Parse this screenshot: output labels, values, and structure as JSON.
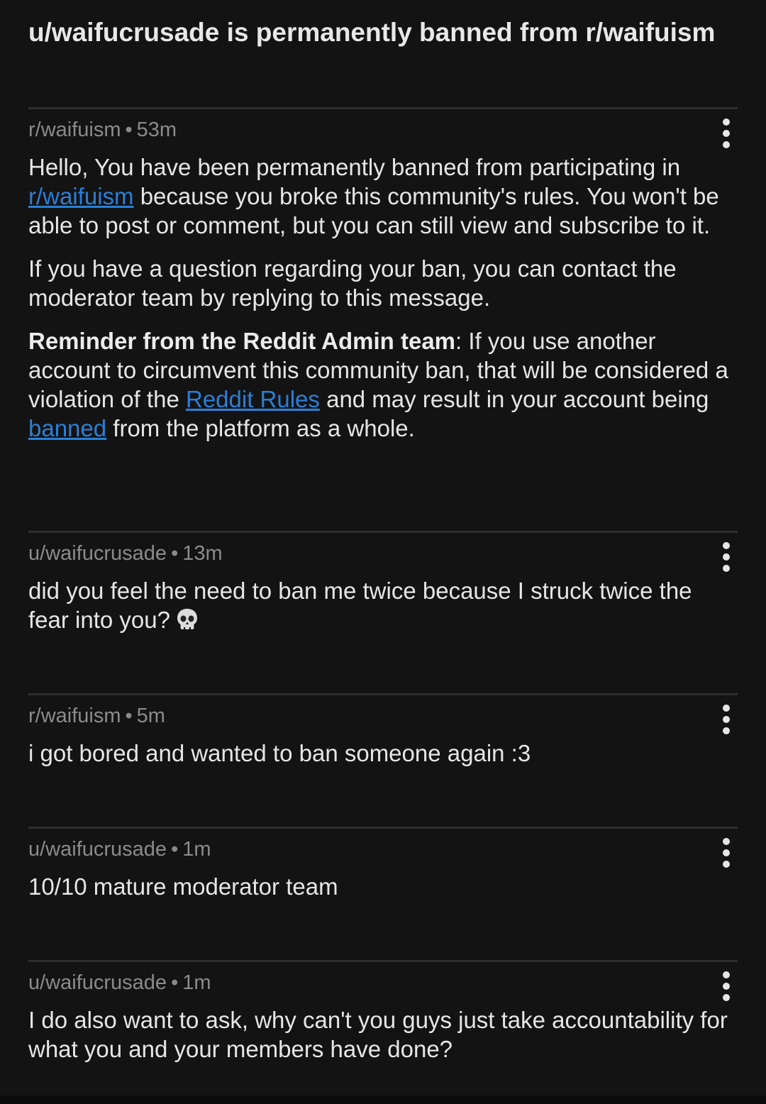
{
  "header": {
    "title": "u/waifucrusade is permanently banned from r/waifuism"
  },
  "messages": [
    {
      "author": "r/waifuism",
      "time": "53m",
      "p1_a": "Hello, You have been permanently banned from participating in ",
      "p1_link": "r/waifuism",
      "p1_b": " because you broke this community's rules. You won't be able to post or comment, but you can still view and subscribe to it.",
      "p2": "If you have a question regarding your ban, you can contact the moderator team by replying to this message.",
      "p3_bold": "Reminder from the Reddit Admin team",
      "p3_a": ": If you use another account to circumvent this community ban, that will be considered a violation of the ",
      "p3_link1": "Reddit Rules",
      "p3_b": " and may result in your account being ",
      "p3_link2": "banned",
      "p3_c": " from the platform as a whole."
    },
    {
      "author": "u/waifucrusade",
      "time": "13m",
      "text": "did you feel the need to ban me twice because I struck twice the fear into you?",
      "emoji": "skull-icon"
    },
    {
      "author": "r/waifuism",
      "time": "5m",
      "text": "i got bored and wanted to ban someone again :3"
    },
    {
      "author": "u/waifucrusade",
      "time": "1m",
      "text": "10/10 mature moderator team"
    },
    {
      "author": "u/waifucrusade",
      "time": "1m",
      "text": "I do also want to ask, why can't you guys just take accountability for what you and your members have done?"
    }
  ]
}
